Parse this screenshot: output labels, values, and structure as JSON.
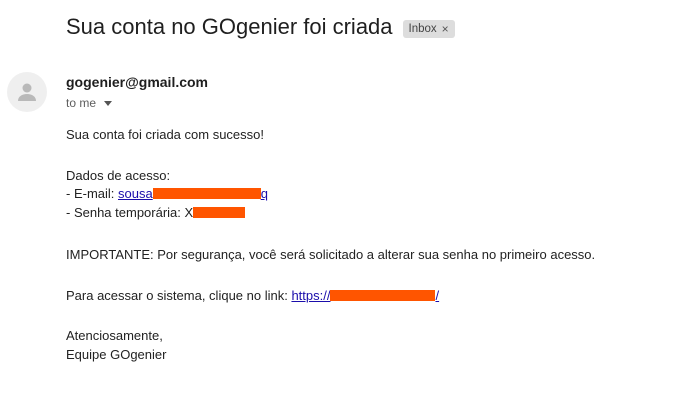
{
  "email": {
    "subject": "Sua conta no GOgenier foi criada",
    "label": "Inbox",
    "label_close": "×",
    "sender": "gogenier@gmail.com",
    "recipient": "to me"
  },
  "body": {
    "line1": "Sua conta foi criada com sucesso!",
    "access_heading": "Dados de acesso:",
    "email_prefix": "- E-mail: ",
    "email_link_visible": "sousa",
    "password_prefix": "- Senha temporária: ",
    "password_visible": "X",
    "important": "IMPORTANTE: Por segurança, você será solicitado a alterar sua senha no primeiro acesso.",
    "access_prefix": "Para acessar o sistema, clique no link: ",
    "access_link_visible": "https://",
    "access_link_tail": "/",
    "closing": "Atenciosamente,",
    "signature": "Equipe GOgenier"
  },
  "colors": {
    "redaction": "#ff5500",
    "link": "#1a0dab"
  },
  "icons": {
    "avatar": "person-icon",
    "recipient_dropdown": "chevron-down-icon"
  }
}
